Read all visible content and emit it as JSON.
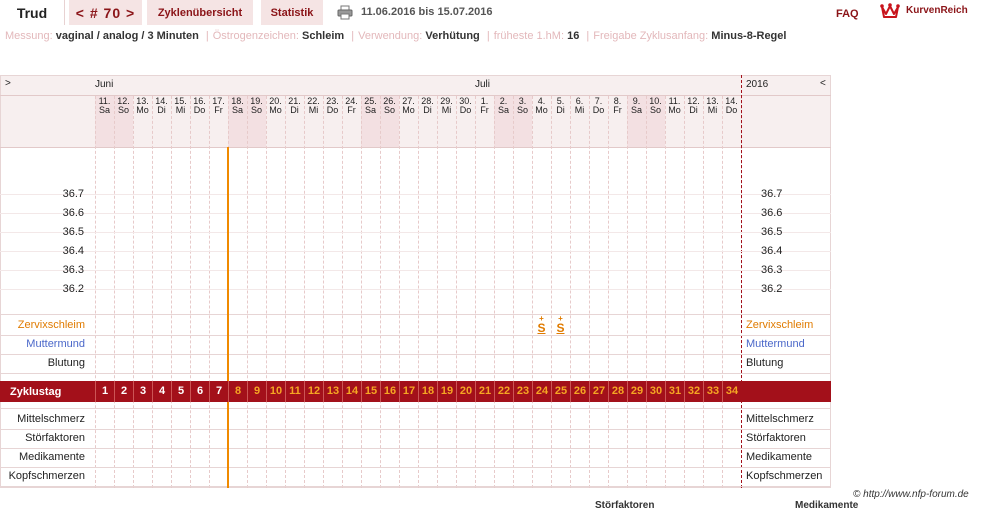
{
  "app": {
    "user": "Trud",
    "cycle_nav": "< # 70 >",
    "tab_overview": "Zyklenübersicht",
    "tab_stats": "Statistik",
    "date_range": "11.06.2016 bis 15.07.2016",
    "faq": "FAQ",
    "brand": "KurvenReich",
    "brand_color": "#8b1418"
  },
  "meta": [
    {
      "label": "Messung:",
      "value": "vaginal / analog / 3 Minuten"
    },
    {
      "label": "Östrogenzeichen:",
      "value": "Schleim"
    },
    {
      "label": "Verwendung:",
      "value": "Verhütung"
    },
    {
      "label": "früheste 1.hM:",
      "value": "16"
    },
    {
      "label": "Freigabe Zyklusanfang:",
      "value": "Minus-8-Regel"
    }
  ],
  "grid": {
    "nav_left": ">",
    "nav_right": "<",
    "months": [
      "Juni",
      "Juli"
    ],
    "year": "2016",
    "days": [
      {
        "d": "11.",
        "w": "Sa"
      },
      {
        "d": "12.",
        "w": "So"
      },
      {
        "d": "13.",
        "w": "Mo"
      },
      {
        "d": "14.",
        "w": "Di"
      },
      {
        "d": "15.",
        "w": "Mi"
      },
      {
        "d": "16.",
        "w": "Do"
      },
      {
        "d": "17.",
        "w": "Fr"
      },
      {
        "d": "18.",
        "w": "Sa"
      },
      {
        "d": "19.",
        "w": "So"
      },
      {
        "d": "20.",
        "w": "Mo"
      },
      {
        "d": "21.",
        "w": "Di"
      },
      {
        "d": "22.",
        "w": "Mi"
      },
      {
        "d": "23.",
        "w": "Do"
      },
      {
        "d": "24.",
        "w": "Fr"
      },
      {
        "d": "25.",
        "w": "Sa"
      },
      {
        "d": "26.",
        "w": "So"
      },
      {
        "d": "27.",
        "w": "Mo"
      },
      {
        "d": "28.",
        "w": "Di"
      },
      {
        "d": "29.",
        "w": "Mi"
      },
      {
        "d": "30.",
        "w": "Do"
      },
      {
        "d": "1.",
        "w": "Fr"
      },
      {
        "d": "2.",
        "w": "Sa"
      },
      {
        "d": "3.",
        "w": "So"
      },
      {
        "d": "4.",
        "w": "Mo"
      },
      {
        "d": "5.",
        "w": "Di"
      },
      {
        "d": "6.",
        "w": "Mi"
      },
      {
        "d": "7.",
        "w": "Do"
      },
      {
        "d": "8.",
        "w": "Fr"
      },
      {
        "d": "9.",
        "w": "Sa"
      },
      {
        "d": "10.",
        "w": "So"
      },
      {
        "d": "11.",
        "w": "Mo"
      },
      {
        "d": "12.",
        "w": "Di"
      },
      {
        "d": "13.",
        "w": "Mi"
      },
      {
        "d": "14.",
        "w": "Do"
      }
    ],
    "temperatures": [
      "36.7",
      "36.6",
      "36.5",
      "36.4",
      "36.3",
      "36.2"
    ],
    "rows_top": [
      "Zervixschleim",
      "Muttermund",
      "Blutung"
    ],
    "cycle_day_label": "Zyklustag",
    "cycle_days": [
      "1",
      "2",
      "3",
      "4",
      "5",
      "6",
      "7",
      "8",
      "9",
      "10",
      "11",
      "12",
      "13",
      "14",
      "15",
      "16",
      "17",
      "18",
      "19",
      "20",
      "21",
      "22",
      "23",
      "24",
      "25",
      "26",
      "27",
      "28",
      "29",
      "30",
      "31",
      "32",
      "33",
      "34"
    ],
    "rows_bottom": [
      "Mittelschmerz",
      "Störfaktoren",
      "Medikamente",
      "Kopfschmerzen"
    ],
    "mucus_marks": [
      {
        "day_index": 23,
        "symbol": "S",
        "sup": "+"
      },
      {
        "day_index": 24,
        "symbol": "S",
        "sup": "+"
      }
    ],
    "cycle_start_line_day_index": 7,
    "colors": {
      "weekend": "#f3e0e2",
      "header_bg": "#f7efef",
      "cycle_bar": "#a3101a",
      "cycle_first_phase_text": "#ffffff",
      "cycle_second_phase_text": "#f5a623",
      "zervix": "#e07b00",
      "muttermund": "#4a67c9",
      "cycle_start_line": "#f08a00"
    }
  },
  "footer": {
    "credit": "© http://www.nfp-forum.de",
    "cut_left": "Störfaktoren",
    "cut_right": "Medikamente"
  }
}
